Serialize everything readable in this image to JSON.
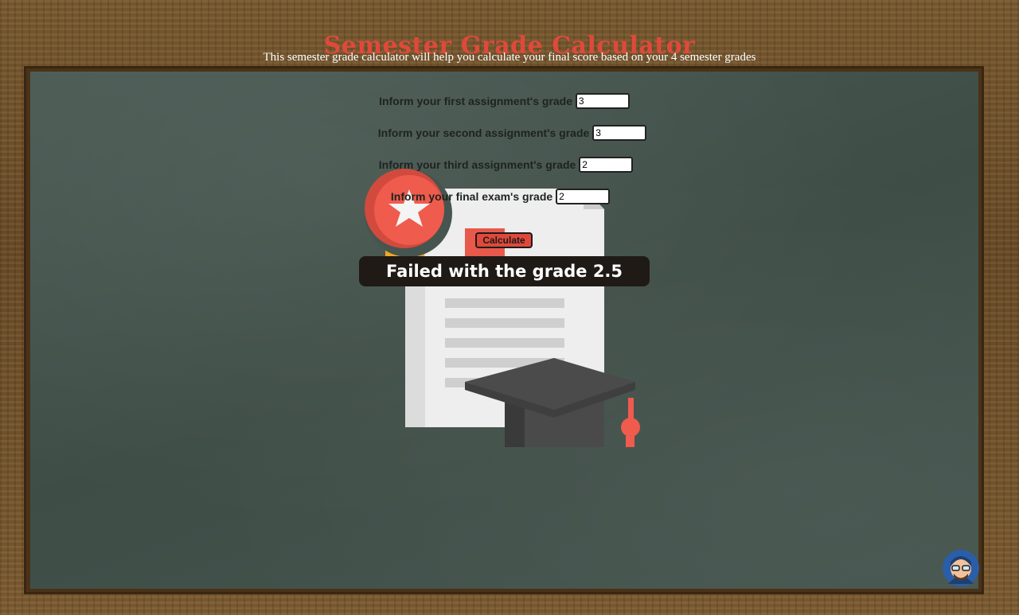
{
  "header": {
    "title": "Semester Grade Calculator",
    "subtitle": "This semester grade calculator will help you calculate your final score based on your 4 semester grades"
  },
  "form": {
    "fields": [
      {
        "label": "Inform your first assignment's grade",
        "value": "3"
      },
      {
        "label": "Inform your second assignment's grade",
        "value": "3"
      },
      {
        "label": "Inform your third assignment's grade",
        "value": "2"
      },
      {
        "label": "Inform your final exam's grade",
        "value": "2"
      }
    ],
    "calculate_label": "Calculate"
  },
  "result": {
    "text": "Failed with the grade 2.5"
  },
  "colors": {
    "title": "#e0493a",
    "board": "#46554f",
    "frame": "#6b4c27",
    "result_bg": "#1f1a16"
  },
  "icons": {
    "illustration": "diploma-certificate-graduation-cap-illustration",
    "avatar": "developer-avatar-icon"
  }
}
